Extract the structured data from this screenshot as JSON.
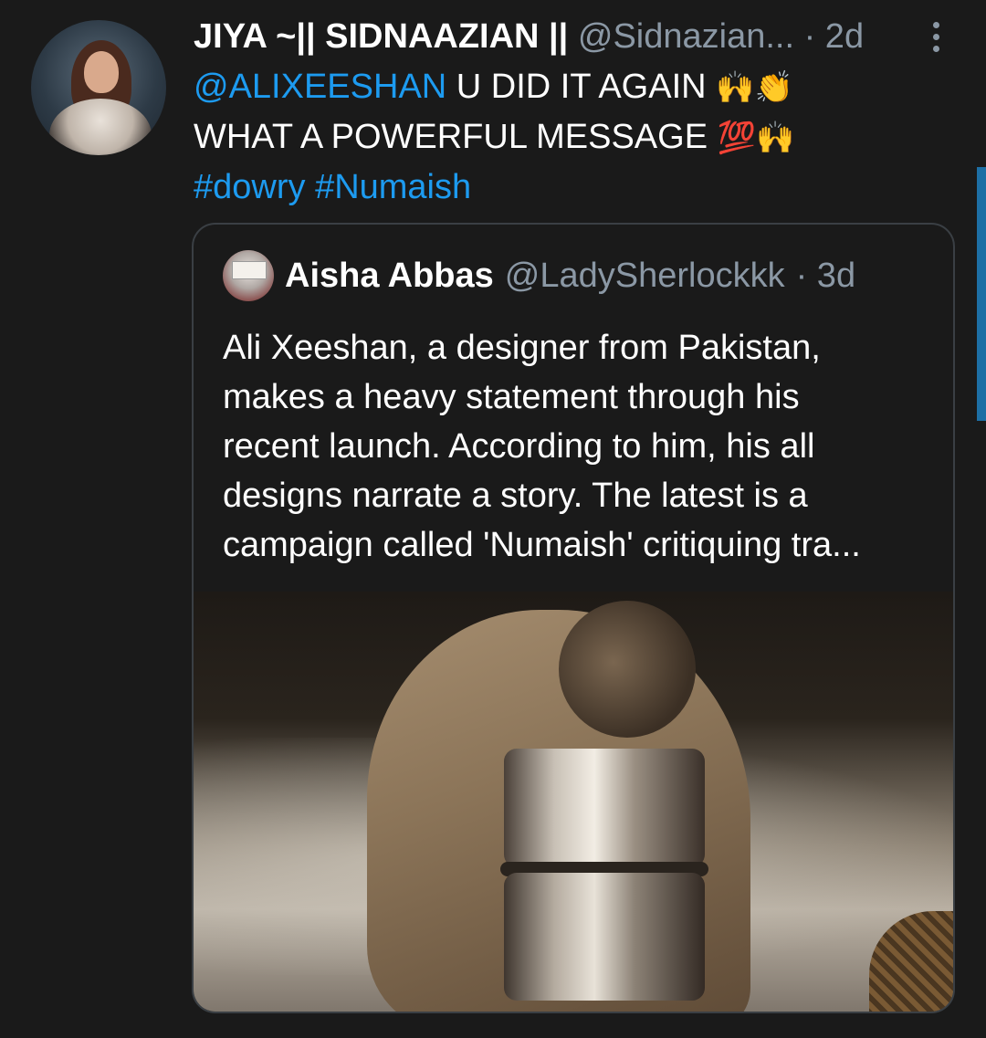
{
  "tweet": {
    "display_name": "JIYA ~|| SIDNAAZIAN ||",
    "handle": "@Sidnazian...",
    "time": "· 2d",
    "text": {
      "line1_mention": "@ALIXEESHAN",
      "line1_text": " U DID IT AGAIN ",
      "line1_emojis": "🙌👏",
      "line2_text": "WHAT A POWERFUL MESSAGE ",
      "line2_emoji_100": "💯",
      "line2_emoji": "🙌",
      "hashtag1": "#dowry",
      "hashtag2": "#Numaish"
    },
    "icons": {
      "more": "more-vertical-icon",
      "avatar": "user-avatar"
    }
  },
  "quoted_tweet": {
    "display_name": "Aisha Abbas",
    "handle": "@LadySherlockkk",
    "time": "· 3d",
    "text_lines": [
      "Ali Xeeshan, a designer from Pakistan,",
      "makes a heavy statement through his",
      "recent launch. According to him, his all",
      "designs narrate a story. The latest is a",
      "campaign called 'Numaish' critiquing tra..."
    ]
  },
  "colors": {
    "background": "#1a1a1a",
    "link": "#1d9bf0",
    "secondary_text": "#8b98a5",
    "border": "#3a3f44"
  }
}
